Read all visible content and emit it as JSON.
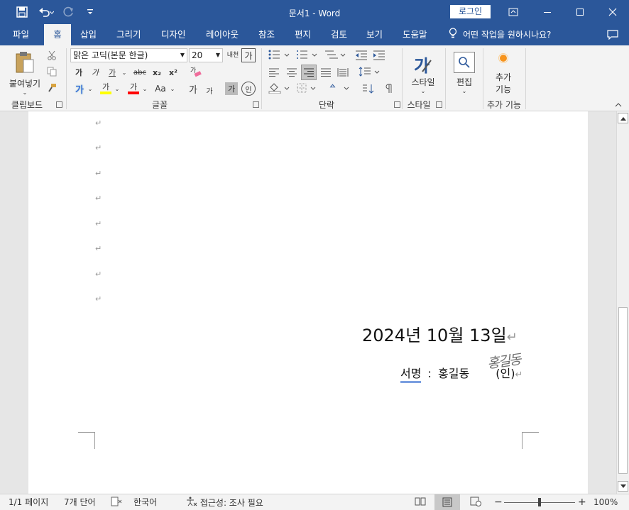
{
  "window": {
    "title": "문서1 - Word",
    "login_label": "로그인"
  },
  "tabs": [
    {
      "label": "파일"
    },
    {
      "label": "홈"
    },
    {
      "label": "삽입"
    },
    {
      "label": "그리기"
    },
    {
      "label": "디자인"
    },
    {
      "label": "레이아웃"
    },
    {
      "label": "참조"
    },
    {
      "label": "편지"
    },
    {
      "label": "검토"
    },
    {
      "label": "보기"
    },
    {
      "label": "도움말"
    }
  ],
  "tell_me": "어떤 작업을 원하시나요?",
  "ribbon": {
    "clipboard": {
      "label": "클립보드",
      "paste_label": "붙여넣기"
    },
    "font": {
      "label": "글꼴",
      "font_name": "맑은 고딕(본문 한글)",
      "font_size": "20",
      "bold": "가",
      "italic": "가",
      "underline": "가",
      "strike": "abc",
      "sub": "x₂",
      "sup": "x²",
      "grow": "가",
      "shrink": "가",
      "clear": "가",
      "highlight": "가",
      "color": "가",
      "case": "Aa",
      "phonetic": "내천",
      "char_border": "가",
      "shade": "가",
      "enclose": "인"
    },
    "paragraph": {
      "label": "단락"
    },
    "styles": {
      "label": "스타일",
      "button_label": "스타일",
      "icon_char": "가"
    },
    "editing": {
      "label": "편집",
      "button_label": "편집"
    },
    "addins": {
      "label": "추가 기능",
      "button_label_1": "추가",
      "button_label_2": "기능"
    }
  },
  "document": {
    "date_line": "2024년 10월 13일",
    "sign_label": "서명",
    "sign_colon": ":",
    "sign_name": "홍길동",
    "seal_text": "(인)",
    "signature_text": "홍길동",
    "para_mark": "↵"
  },
  "status": {
    "page": "1/1 페이지",
    "words": "7개 단어",
    "language": "한국어",
    "accessibility": "접근성: 조사 필요",
    "zoom": "100%",
    "zoom_level": 1.0
  },
  "colors": {
    "accent": "#2b579a",
    "highlight": "#ffff00",
    "font_red": "#ff0000",
    "sign_underline": "#7b9fe0"
  }
}
